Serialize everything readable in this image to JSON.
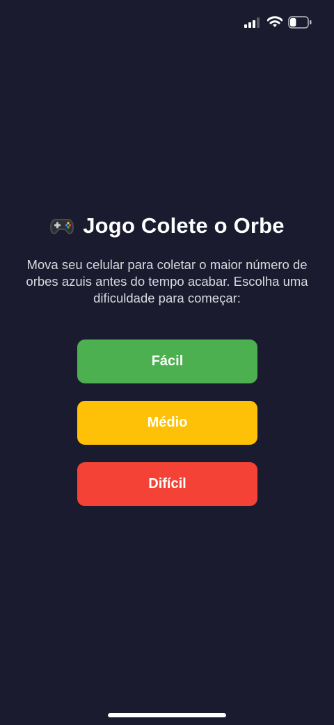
{
  "status_bar": {
    "signal_icon": "cellular-signal-icon",
    "wifi_icon": "wifi-icon",
    "battery_icon": "battery-icon",
    "battery_level": 0.35
  },
  "header": {
    "icon": "gamepad-icon",
    "title": "Jogo Colete o Orbe"
  },
  "intro": {
    "description": "Mova seu celular para coletar o maior número de orbes azuis antes do tempo acabar. Escolha uma dificuldade para começar:"
  },
  "difficulty": {
    "buttons": [
      {
        "label": "Fácil",
        "color": "#4caf50"
      },
      {
        "label": "Médio",
        "color": "#ffc107"
      },
      {
        "label": "Difícil",
        "color": "#f44336"
      }
    ]
  },
  "colors": {
    "background": "#1a1b2e",
    "text": "#ffffff"
  }
}
